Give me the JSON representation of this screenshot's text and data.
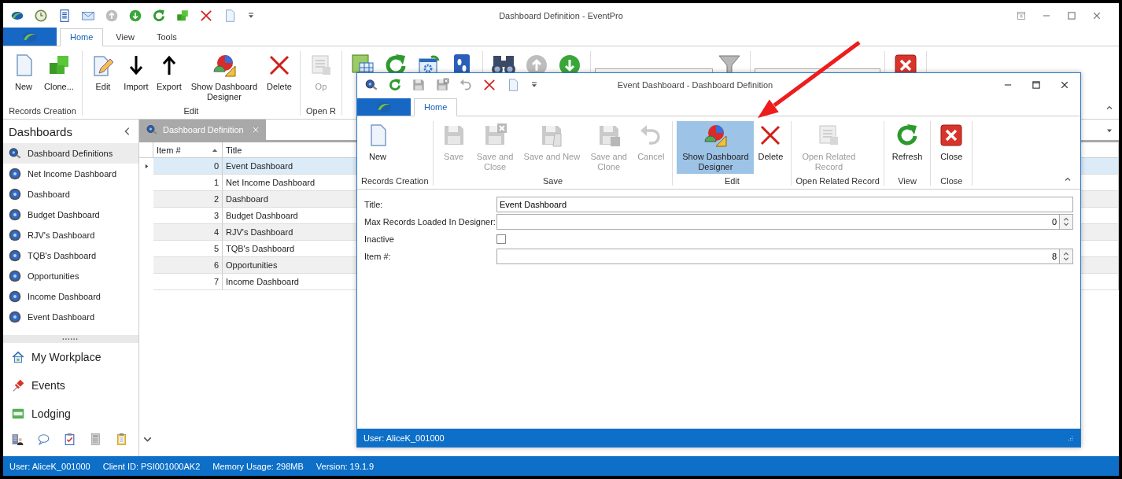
{
  "window": {
    "title": "Dashboard Definition - EventPro"
  },
  "ribbon": {
    "tabs": [
      {
        "label": "Home",
        "selected": true
      },
      {
        "label": "View",
        "selected": false
      },
      {
        "label": "Tools",
        "selected": false
      }
    ],
    "groups": [
      {
        "label": "Records Creation",
        "buttons": [
          {
            "label": "New",
            "disabled": false
          },
          {
            "label": "Clone...",
            "disabled": false
          }
        ]
      },
      {
        "label": "Edit",
        "buttons": [
          {
            "label": "Edit",
            "disabled": false
          },
          {
            "label": "Import",
            "disabled": false
          },
          {
            "label": "Export",
            "disabled": false
          },
          {
            "label": "Show Dashboard Designer",
            "disabled": false
          },
          {
            "label": "Delete",
            "disabled": false
          }
        ]
      },
      {
        "label": "Open R",
        "buttons": [
          {
            "label": "Op",
            "disabled": true
          }
        ]
      }
    ]
  },
  "sidebar": {
    "title": "Dashboards",
    "items": [
      {
        "label": "Dashboard Definitions",
        "selected": true
      },
      {
        "label": "Net Income Dashboard",
        "selected": false
      },
      {
        "label": "Dashboard",
        "selected": false
      },
      {
        "label": "Budget Dashboard",
        "selected": false
      },
      {
        "label": "RJV's Dashboard",
        "selected": false
      },
      {
        "label": "TQB's Dashboard",
        "selected": false
      },
      {
        "label": "Opportunities",
        "selected": false
      },
      {
        "label": "Income Dashboard",
        "selected": false
      },
      {
        "label": "Event Dashboard",
        "selected": false
      }
    ],
    "nav": [
      {
        "label": "My Workplace"
      },
      {
        "label": "Events"
      },
      {
        "label": "Lodging"
      }
    ]
  },
  "document_tab": {
    "label": "Dashboard Definition"
  },
  "table": {
    "columns": [
      "Item #",
      "Title"
    ],
    "rows": [
      {
        "item": "0",
        "title": "Event Dashboard",
        "selected": true
      },
      {
        "item": "1",
        "title": "Net Income Dashboard",
        "selected": false
      },
      {
        "item": "2",
        "title": "Dashboard",
        "selected": false
      },
      {
        "item": "3",
        "title": "Budget Dashboard",
        "selected": false
      },
      {
        "item": "4",
        "title": "RJV's Dashboard",
        "selected": false
      },
      {
        "item": "5",
        "title": "TQB's Dashboard",
        "selected": false
      },
      {
        "item": "6",
        "title": "Opportunities",
        "selected": false
      },
      {
        "item": "7",
        "title": "Income Dashboard",
        "selected": false
      }
    ]
  },
  "status_bar": [
    "User: AliceK_001000",
    "Client ID: PSI001000AK2",
    "Memory Usage: 298MB",
    "Version: 19.1.9"
  ],
  "dialog": {
    "title": "Event Dashboard - Dashboard Definition",
    "tabs": [
      {
        "label": "Home",
        "selected": true
      }
    ],
    "groups": [
      {
        "label": "Records Creation",
        "buttons": [
          {
            "label": "New",
            "disabled": false,
            "highlighted": false
          }
        ]
      },
      {
        "label": "Save",
        "buttons": [
          {
            "label": "Save",
            "disabled": true,
            "highlighted": false
          },
          {
            "label": "Save and Close",
            "disabled": true,
            "highlighted": false
          },
          {
            "label": "Save and New",
            "disabled": true,
            "highlighted": false
          },
          {
            "label": "Save and Clone",
            "disabled": true,
            "highlighted": false
          },
          {
            "label": "Cancel",
            "disabled": true,
            "highlighted": false
          }
        ]
      },
      {
        "label": "Edit",
        "buttons": [
          {
            "label": "Show Dashboard Designer",
            "disabled": false,
            "highlighted": true
          },
          {
            "label": "Delete",
            "disabled": false,
            "highlighted": false
          }
        ]
      },
      {
        "label": "Open Related Record",
        "buttons": [
          {
            "label": "Open Related Record",
            "disabled": true,
            "highlighted": false
          }
        ]
      },
      {
        "label": "View",
        "buttons": [
          {
            "label": "Refresh",
            "disabled": false,
            "highlighted": false
          }
        ]
      },
      {
        "label": "Close",
        "buttons": [
          {
            "label": "Close",
            "disabled": false,
            "highlighted": false
          }
        ]
      }
    ],
    "fields": [
      {
        "label": "Title:",
        "kind": "text",
        "value": "Event Dashboard"
      },
      {
        "label": "Max Records Loaded In Designer:",
        "kind": "number",
        "value": "0"
      },
      {
        "label": "Inactive",
        "kind": "checkbox",
        "checked": false
      },
      {
        "label": "Item #:",
        "kind": "number",
        "value": "8"
      }
    ],
    "status_bar": "User: AliceK_001000"
  }
}
